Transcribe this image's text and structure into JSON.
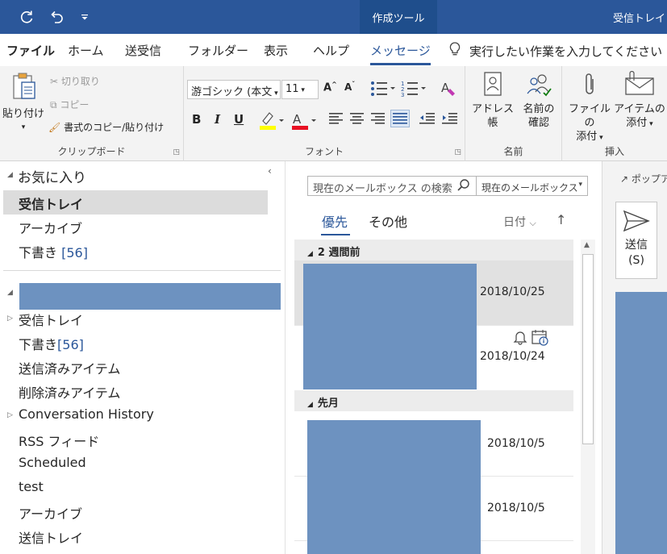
{
  "titlebar": {
    "refresh_icon": "refresh-icon",
    "undo_icon": "undo-icon",
    "qat_dropdown_icon": "customize-dropdown-icon",
    "context_tab": "作成ツール",
    "window_title": "受信トレイ",
    "bg_color": "#2b579a"
  },
  "tabs": {
    "file": "ファイル",
    "home": "ホーム",
    "send_receive": "送受信",
    "folder": "フォルダー",
    "view": "表示",
    "help": "ヘルプ",
    "message": "メッセージ",
    "tell_me": "実行したい作業を入力してください"
  },
  "ribbon": {
    "clipboard": {
      "paste": "貼り付け",
      "cut": "切り取り",
      "copy": "コピー",
      "format_painter": "書式のコピー/貼り付け",
      "label": "クリップボード"
    },
    "font": {
      "font_name": "游ゴシック (本文",
      "font_size": "11",
      "bold": "B",
      "italic": "I",
      "underline": "U",
      "label": "フォント",
      "highlight_color": "#ffff00",
      "font_color": "#e81123"
    },
    "names": {
      "address_book": "アドレス帳",
      "check_names_1": "名前の",
      "check_names_2": "確認",
      "label": "名前"
    },
    "insert": {
      "attach_file_1": "ファイルの",
      "attach_file_2": "添付",
      "attach_item_1": "アイテムの",
      "attach_item_2": "添付",
      "label": "挿入"
    }
  },
  "folderpane": {
    "favorites_header": "お気に入り",
    "favorites": [
      {
        "label": "受信トレイ",
        "count": ""
      },
      {
        "label": "アーカイブ",
        "count": ""
      },
      {
        "label": "下書き",
        "count": "[56]"
      }
    ],
    "folders": [
      {
        "label": "受信トレイ",
        "count": ""
      },
      {
        "label": "下書き",
        "count": "[56]"
      },
      {
        "label": "送信済みアイテム",
        "count": ""
      },
      {
        "label": "削除済みアイテム",
        "count": ""
      },
      {
        "label": "Conversation History",
        "count": ""
      },
      {
        "label": "RSS フィード",
        "count": ""
      },
      {
        "label": "Scheduled",
        "count": ""
      },
      {
        "label": "test",
        "count": ""
      },
      {
        "label": "アーカイブ",
        "count": ""
      },
      {
        "label": "送信トレイ",
        "count": ""
      }
    ]
  },
  "msglist": {
    "search_placeholder": "現在のメールボックス の検索",
    "scope": "現在のメールボックス",
    "tab_focused": "優先",
    "tab_other": "その他",
    "sort_by": "日付",
    "group_1": "2 週間前",
    "group_2": "先月",
    "messages": [
      {
        "date": "2018/10/25"
      },
      {
        "date": "2018/10/24"
      },
      {
        "date": "2018/10/5"
      },
      {
        "date": "2018/10/5"
      }
    ]
  },
  "reading": {
    "popout": "ポップアウト",
    "send_1": "送信",
    "send_2": "(S)"
  }
}
